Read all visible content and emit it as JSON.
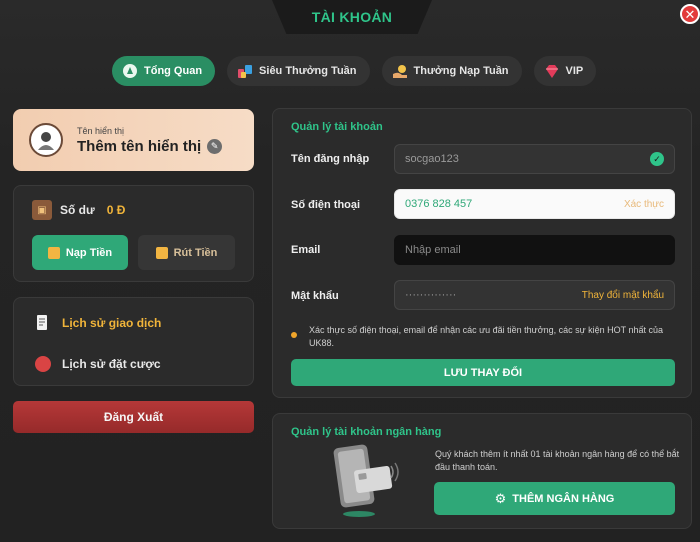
{
  "window": {
    "title": "TÀI KHOẢN",
    "close_glyph": "✕"
  },
  "tabs": [
    {
      "label": "Tổng Quan",
      "icon": "overview-icon",
      "active": true
    },
    {
      "label": "Siêu Thưởng Tuần",
      "icon": "weekly-super-bonus-icon",
      "active": false
    },
    {
      "label": "Thưởng Nạp Tuần",
      "icon": "weekly-deposit-bonus-icon",
      "active": false
    },
    {
      "label": "VIP",
      "icon": "vip-diamond-icon",
      "active": false
    }
  ],
  "profile": {
    "small_label": "Tên hiển thị",
    "name": "Thêm tên hiển thị",
    "edit_glyph": "✎"
  },
  "balance": {
    "label": "Số dư",
    "value": "0 Đ",
    "deposit_label": "Nạp Tiền",
    "withdraw_label": "Rút Tiền"
  },
  "history": {
    "transactions_label": "Lịch sử giao dịch",
    "bets_label": "Lịch sử đặt cược"
  },
  "logout_label": "Đăng Xuất",
  "account": {
    "title": "Quản lý tài khoản",
    "username_label": "Tên đăng nhập",
    "username_value": "socgao123",
    "phone_label": "Số điện thoại",
    "phone_value": "0376 828 457",
    "phone_verify": "Xác thực",
    "email_label": "Email",
    "email_placeholder": "Nhập email",
    "password_label": "Mật khẩu",
    "password_value": "··············",
    "password_change": "Thay đổi mật khẩu",
    "note": "Xác thực số điện thoại, email để nhận các ưu đãi tiền thưởng, các sự kiện HOT nhất của UK88.",
    "save_label": "LƯU THAY ĐỔI"
  },
  "bank": {
    "title": "Quản lý tài khoản ngân hàng",
    "text": "Quý khách thêm ít nhất 01 tài khoản ngân hàng để có thể bắt đầu thanh toán.",
    "add_label": "THÊM NGÂN HÀNG"
  },
  "colors": {
    "accent_green": "#2fa878",
    "title_green": "#2fc48a",
    "gold": "#f0b43a",
    "danger": "#b53838"
  }
}
